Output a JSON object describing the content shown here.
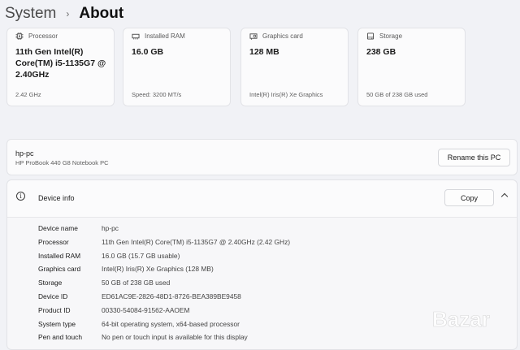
{
  "breadcrumb": {
    "root": "System",
    "separator": "›",
    "current": "About"
  },
  "cards": [
    {
      "label": "Processor",
      "value": "11th Gen Intel(R) Core(TM) i5-1135G7 @ 2.40GHz",
      "detail": "2.42 GHz",
      "icon": "processor-icon"
    },
    {
      "label": "Installed RAM",
      "value": "16.0 GB",
      "detail": "Speed: 3200 MT/s",
      "icon": "ram-icon"
    },
    {
      "label": "Graphics card",
      "value": "128 MB",
      "detail": "Intel(R) Iris(R) Xe Graphics",
      "icon": "graphics-card-icon"
    },
    {
      "label": "Storage",
      "value": "238 GB",
      "detail": "50 GB of 238 GB used",
      "icon": "storage-icon"
    }
  ],
  "device": {
    "name": "hp-pc",
    "model": "HP ProBook 440 G8 Notebook PC",
    "rename_label": "Rename this PC"
  },
  "device_info": {
    "title": "Device info",
    "copy_label": "Copy",
    "specs": [
      {
        "key": "Device name",
        "value": "hp-pc"
      },
      {
        "key": "Processor",
        "value": "11th Gen Intel(R) Core(TM) i5-1135G7 @ 2.40GHz (2.42 GHz)"
      },
      {
        "key": "Installed RAM",
        "value": "16.0 GB (15.7 GB usable)"
      },
      {
        "key": "Graphics card",
        "value": "Intel(R) Iris(R) Xe Graphics (128 MB)"
      },
      {
        "key": "Storage",
        "value": "50 GB of 238 GB used"
      },
      {
        "key": "Device ID",
        "value": "ED61AC9E-2826-48D1-8726-BEA389BE9458"
      },
      {
        "key": "Product ID",
        "value": "00330-54084-91562-AAOEM"
      },
      {
        "key": "System type",
        "value": "64-bit operating system, x64-based processor"
      },
      {
        "key": "Pen and touch",
        "value": "No pen or touch input is available for this display"
      }
    ]
  },
  "watermark": {
    "text": "Bazar"
  }
}
